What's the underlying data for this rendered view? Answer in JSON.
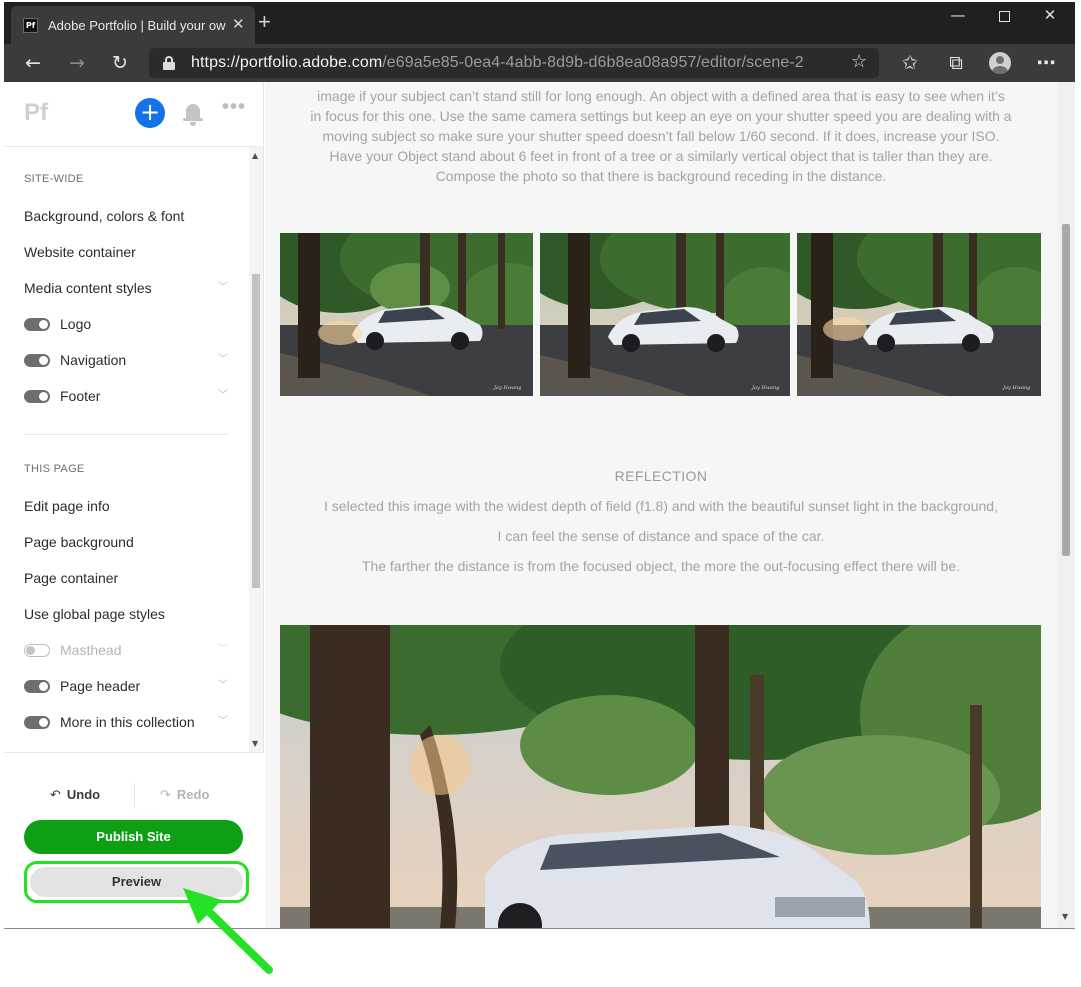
{
  "browser": {
    "tab_title": "Adobe Portfolio | Build your own",
    "tab_favicon": "Pf",
    "new_tab_label": "+",
    "window_min": "—",
    "window_close": "✕",
    "url_host": "https://portfolio.adobe.com",
    "url_path": "/e69a5e85-0ea4-4abb-8d9b-d6b8ea08a957/editor/scene-2",
    "icons": {
      "back": "arrow-left-icon",
      "forward": "arrow-right-icon",
      "refresh": "refresh-icon",
      "lock": "lock-icon",
      "favorite": "star-icon",
      "favorites_list": "favorites-list-icon",
      "collections": "collections-icon",
      "profile": "profile-icon",
      "more": "more-icon"
    }
  },
  "sidebar": {
    "logo": "Pf",
    "add_label": "+",
    "more_label": "•••",
    "site_wide": {
      "header": "SITE-WIDE",
      "items": [
        {
          "label": "Background, colors & font"
        },
        {
          "label": "Website container"
        },
        {
          "label": "Media content styles",
          "chevron": true
        },
        {
          "label": "Logo",
          "toggle": "on"
        },
        {
          "label": "Navigation",
          "toggle": "on",
          "chevron": true
        },
        {
          "label": "Footer",
          "toggle": "on",
          "chevron": true
        }
      ]
    },
    "this_page": {
      "header": "THIS PAGE",
      "items": [
        {
          "label": "Edit page info"
        },
        {
          "label": "Page background"
        },
        {
          "label": "Page container"
        },
        {
          "label": "Use global page styles"
        },
        {
          "label": "Masthead",
          "toggle": "off",
          "chevron": true,
          "disabled": true
        },
        {
          "label": "Page header",
          "toggle": "on",
          "chevron": true
        },
        {
          "label": "More in this collection",
          "toggle": "on",
          "chevron": true
        }
      ]
    },
    "footer": {
      "undo_label": "Undo",
      "redo_label": "Redo",
      "publish_label": "Publish Site",
      "preview_label": "Preview"
    },
    "colors": {
      "add_button": "#1473e6",
      "publish_button": "#0e9f15",
      "highlight": "#24e126"
    }
  },
  "main": {
    "intro_lines": [
      "image if your subject can’t stand still for long enough. An object with a defined area that is easy to see when it’s",
      "in focus for this one. Use the same camera settings but keep an eye on your shutter speed you are dealing with a",
      "moving subject so make sure your shutter speed doesn’t fall below 1/60 second. If it does, increase your ISO.",
      "Have your Object stand about 6 feet in front of a tree or a similarly vertical object that is taller than they are.",
      "Compose the photo so that there is background receding in the distance."
    ],
    "photo_credit": "Jay Hwang",
    "reflection": {
      "title": "REFLECTION",
      "line1": "I selected this image with the widest depth of field (f1.8) and with the beautiful sunset light in the background,",
      "line2": "I can feel the sense of distance and space of the car.",
      "line3": "The farther the distance is from the focused object, the more the out-focusing effect there will be."
    }
  },
  "annotation": {
    "arrow_color": "#24e126"
  }
}
